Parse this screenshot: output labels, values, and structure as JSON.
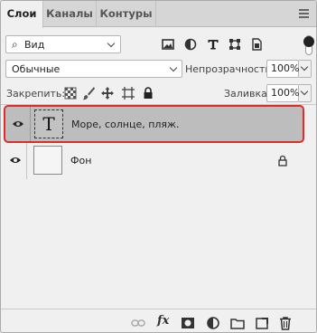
{
  "tabs": [
    {
      "label": "Слои",
      "active": true
    },
    {
      "label": "Каналы",
      "active": false
    },
    {
      "label": "Контуры",
      "active": false
    }
  ],
  "filter": {
    "kind_label": "Вид",
    "icons": [
      "image-filter-icon",
      "adjustment-filter-icon",
      "type-filter-icon",
      "shape-filter-icon",
      "smart-object-filter-icon"
    ]
  },
  "blend": {
    "mode": "Обычные",
    "opacity_label": "Непрозрачность:",
    "opacity_value": "100%"
  },
  "lock": {
    "label": "Закрепить:",
    "icons": [
      "lock-transparent-icon",
      "lock-image-icon",
      "lock-position-icon",
      "lock-artboard-icon",
      "lock-all-icon"
    ],
    "fill_label": "Заливка:",
    "fill_value": "100%"
  },
  "layers": [
    {
      "name": "Море, солнце, пляж.",
      "type": "text",
      "thumb_glyph": "T",
      "visible": true,
      "selected": true,
      "locked": false
    },
    {
      "name": "Фон",
      "type": "background",
      "visible": true,
      "selected": false,
      "locked": true
    }
  ],
  "bottom_toolbar": {
    "fx_label": "fx",
    "icons": [
      "link-layers-icon",
      "fx-icon",
      "add-mask-icon",
      "new-adjustment-icon",
      "new-group-icon",
      "new-layer-icon",
      "delete-layer-icon"
    ]
  },
  "colors": {
    "panel_bg": "#f0f0f0",
    "selected_row": "#bdbdbd",
    "highlight_border": "#e02b2b"
  }
}
